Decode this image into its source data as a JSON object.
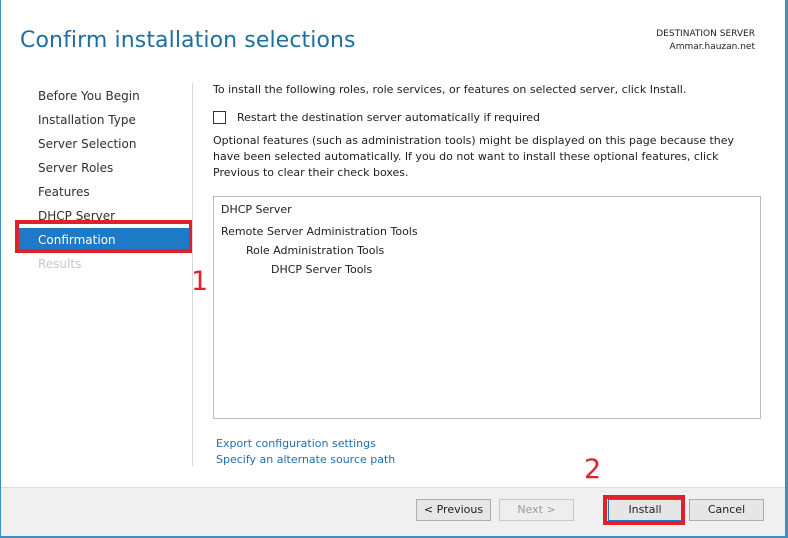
{
  "wizard": {
    "title": "Confirm installation selections",
    "destination_label": "DESTINATION SERVER",
    "destination_server": "Ammar.hauzan.net"
  },
  "sidebar": {
    "items": [
      {
        "label": "Before You Begin",
        "state": "normal"
      },
      {
        "label": "Installation Type",
        "state": "normal"
      },
      {
        "label": "Server Selection",
        "state": "normal"
      },
      {
        "label": "Server Roles",
        "state": "normal"
      },
      {
        "label": "Features",
        "state": "normal"
      },
      {
        "label": "DHCP Server",
        "state": "normal"
      },
      {
        "label": "Confirmation",
        "state": "active"
      },
      {
        "label": "Results",
        "state": "disabled"
      }
    ]
  },
  "content": {
    "intro": "To install the following roles, role services, or features on selected server, click Install.",
    "restart_checkbox_label": "Restart the destination server automatically if required",
    "restart_checked": false,
    "optional_note": "Optional features (such as administration tools) might be displayed on this page because they have been selected automatically. If you do not want to install these optional features, click Previous to clear their check boxes.",
    "selections": [
      {
        "label": "DHCP Server",
        "level": 0
      },
      {
        "label": "Remote Server Administration Tools",
        "level": 0
      },
      {
        "label": "Role Administration Tools",
        "level": 1
      },
      {
        "label": "DHCP Server Tools",
        "level": 2
      }
    ],
    "export_link": "Export configuration settings",
    "source_link": "Specify an alternate source path"
  },
  "buttons": {
    "previous": "< Previous",
    "next": "Next >",
    "install": "Install",
    "cancel": "Cancel"
  },
  "annotations": {
    "marker_1": "1",
    "marker_2": "2",
    "color": "#e0202a"
  },
  "colors": {
    "accent": "#1e79c6",
    "title": "#1f6e9f",
    "link": "#1f6eb5"
  }
}
